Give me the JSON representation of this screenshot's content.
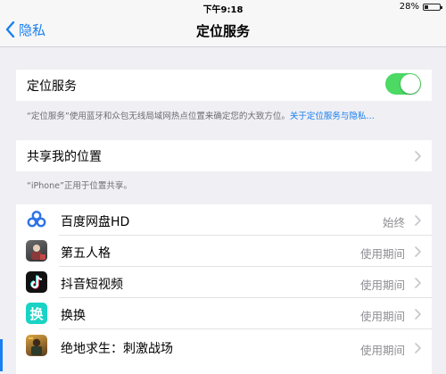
{
  "status_bar": {
    "time": "下午9:18",
    "battery_percent": "28%",
    "battery_level": 0.28
  },
  "nav": {
    "back_label": "隐私",
    "title": "定位服务"
  },
  "location_services": {
    "label": "定位服务",
    "enabled": true,
    "footnote_text": "“定位服务”使用蓝牙和众包无线局域网热点位置来确定您的大致方位。",
    "footnote_link": "关于定位服务与隐私…"
  },
  "share_location": {
    "label": "共享我的位置",
    "footnote": "“iPhone”正用于位置共享。"
  },
  "apps": [
    {
      "name": "百度网盘HD",
      "status": "始终",
      "icon": "baidu-netdisk-icon"
    },
    {
      "name": "第五人格",
      "status": "使用期间",
      "icon": "identity-v-icon"
    },
    {
      "name": "抖音短视频",
      "status": "使用期间",
      "icon": "douyin-icon"
    },
    {
      "name": "换换",
      "status": "使用期间",
      "icon": "huanhuan-icon",
      "icon_glyph": "换"
    },
    {
      "name": "绝地求生：刺激战场",
      "status": "使用期间",
      "icon": "pubg-mobile-icon"
    }
  ],
  "colors": {
    "accent": "#1a7ff0",
    "toggle_on": "#4cd964",
    "background": "#efeff4"
  }
}
